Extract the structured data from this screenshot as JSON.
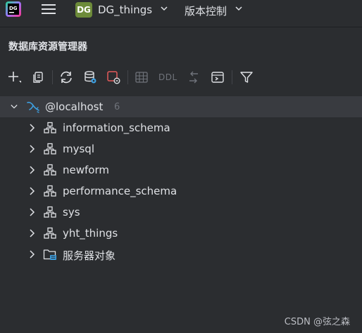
{
  "titlebar": {
    "project_badge": "DG",
    "project_name": "DG_things",
    "vcs_label": "版本控制"
  },
  "panel": {
    "title": "数据库资源管理器"
  },
  "toolbar": {
    "ddl_label": "DDL"
  },
  "tree": {
    "root": {
      "label": "@localhost",
      "count": "6"
    },
    "schemas": [
      {
        "label": "information_schema"
      },
      {
        "label": "mysql"
      },
      {
        "label": "newform"
      },
      {
        "label": "performance_schema"
      },
      {
        "label": "sys"
      },
      {
        "label": "yht_things"
      }
    ],
    "server_objects": {
      "label": "服务器对象"
    }
  },
  "watermark": "CSDN @弦之森",
  "colors": {
    "background": "#2b2d30",
    "selected_row": "#393b40",
    "accent_blue": "#3d9fe0",
    "alert_red": "#e55b5b",
    "badge_green": "#6d8b3a"
  }
}
